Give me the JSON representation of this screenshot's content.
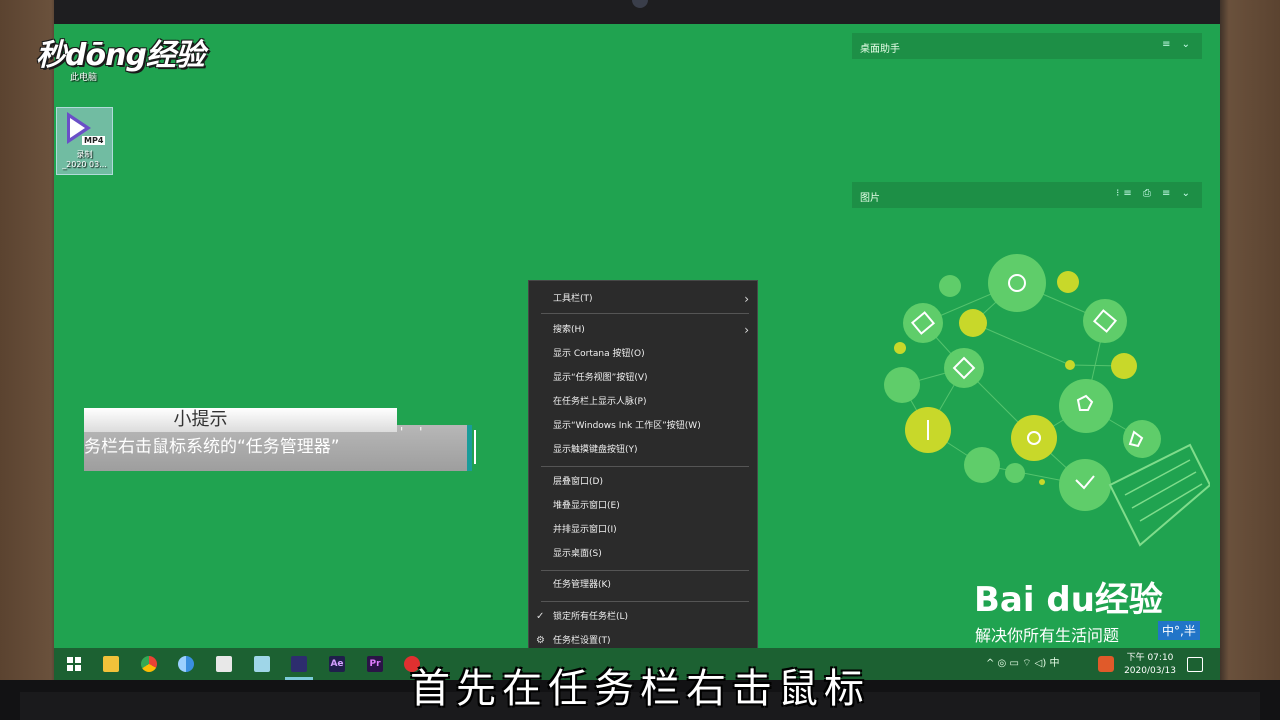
{
  "watermark": {
    "logo": "秒dōng经验",
    "this_pc": "此电脑"
  },
  "desktop": {
    "mp4_icon": {
      "tag": "MP4",
      "line1": "录制",
      "line2": "_2020 03..."
    }
  },
  "widgets": {
    "desktop_assistant": {
      "title": "桌面助手",
      "icons": "≡ ⌄"
    },
    "pictures": {
      "title": "图片",
      "icons": "⁝≡ ⎙ ≡ ⌄"
    }
  },
  "tip": {
    "title": "小提示",
    "body": "务栏右击鼠标系统的“任务管理器”",
    "dots": "' '"
  },
  "context_menu": {
    "items": [
      {
        "label": "工具栏(T)",
        "arrow": "›"
      },
      {
        "label": "搜索(H)",
        "arrow": "›"
      },
      {
        "label": "显示 Cortana 按钮(O)"
      },
      {
        "label": "显示“任务视图”按钮(V)"
      },
      {
        "label": "在任务栏上显示人脉(P)"
      },
      {
        "label": "显示“Windows Ink 工作区”按钮(W)"
      },
      {
        "label": "显示触摸键盘按钮(Y)"
      },
      {
        "label": "层叠窗口(D)"
      },
      {
        "label": "堆叠显示窗口(E)"
      },
      {
        "label": "并排显示窗口(I)"
      },
      {
        "label": "显示桌面(S)"
      },
      {
        "label": "任务管理器(K)"
      },
      {
        "label": "锁定所有任务栏(L)",
        "lead": "✓"
      },
      {
        "label": "任务栏设置(T)",
        "lead": "⚙"
      }
    ]
  },
  "branding": {
    "baidu": "Bai du经验",
    "slogan": "解决你所有生活问题",
    "ime": "中°,半"
  },
  "taskbar": {
    "icons": [
      "windows-icon",
      "file-explorer-icon",
      "chrome-icon",
      "chrome-canary-icon",
      "media-player-icon",
      "notepad-icon",
      "premiere-clip-icon",
      "after-effects-icon",
      "premiere-icon",
      "recorder-icon"
    ],
    "ae_label": "Ae",
    "pr_label": "Pr",
    "tray": "^  ◎  ▭  ⌔  ◁)  中",
    "time": "下午 07:10",
    "date": "2020/03/13"
  },
  "subtitle": "首先在任务栏右击鼠标",
  "colors": {
    "desktop": "#20a350",
    "taskbar": "#1c6132",
    "menu_bg": "#2b2b2b",
    "accent_teal": "#1a9c9a"
  }
}
